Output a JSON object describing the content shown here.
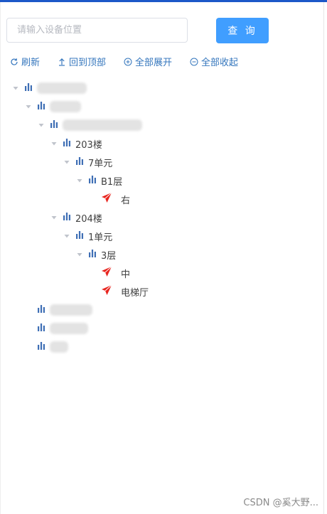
{
  "search": {
    "placeholder": "请输入设备位置",
    "value": ""
  },
  "query_button": {
    "label": "查 询"
  },
  "actions": {
    "refresh": "刷新",
    "back_to_top": "回到顶部",
    "expand_all": "全部展开",
    "collapse_all": "全部收起"
  },
  "tree": {
    "building_203": "203楼",
    "unit_7": "7单元",
    "floor_b1": "B1层",
    "device_right": "右",
    "building_204": "204楼",
    "unit_1": "1单元",
    "floor_3": "3层",
    "device_middle": "中",
    "device_elevator_hall": "电梯厅"
  },
  "watermark": "CSDN @奚大野...",
  "colors": {
    "accent": "#409eff",
    "link": "#3476bd",
    "bar_icon": "#3f6fb5",
    "device_icon": "#e8251f",
    "top_bar": "#1c58c8"
  }
}
